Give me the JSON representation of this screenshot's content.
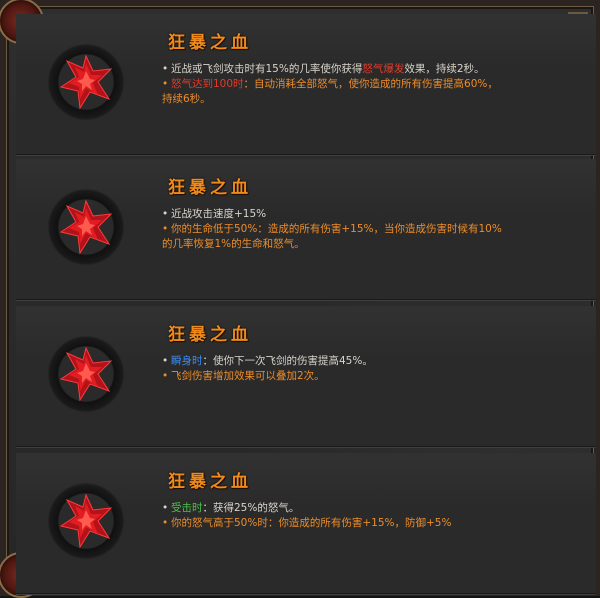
{
  "panels": [
    {
      "title": "狂暴之血",
      "icon": "red-crystal-icon",
      "lines": [
        {
          "bullet": "•",
          "pre": "近战或飞剑攻击时有15%的几率使你获得",
          "hl": "怒气爆发",
          "post": "效果，持续2秒。"
        },
        {
          "bullet": "•",
          "hl": "怒气达到100时",
          "post": "：自动消耗全部怒气，使你造成的所有伤害提高60%，"
        },
        {
          "text": "持续6秒。"
        }
      ]
    },
    {
      "title": "狂暴之血",
      "icon": "red-crystal-icon",
      "lines": [
        {
          "bullet": "•",
          "text": "近战攻击速度+15%"
        },
        {
          "bullet": "•",
          "text": "你的生命低于50%：造成的所有伤害+15%，当你造成伤害时候有10%"
        },
        {
          "text": "的几率恢复1%的生命和怒气。"
        }
      ]
    },
    {
      "title": "狂暴之血",
      "icon": "red-crystal-icon",
      "lines": [
        {
          "bullet": "•",
          "hl": "瞬身时",
          "post": "：使你下一次飞剑的伤害提高45%。"
        },
        {
          "bullet": "•",
          "text": "飞剑伤害增加效果可以叠加2次。"
        }
      ]
    },
    {
      "title": "狂暴之血",
      "icon": "red-crystal-icon",
      "lines": [
        {
          "bullet": "•",
          "hl": "受击时",
          "post": "：获得25%的怒气。"
        },
        {
          "bullet": "•",
          "text": "你的怒气高于50%时：你造成的所有伤害+15%，防御+5%"
        }
      ]
    }
  ],
  "colors": {
    "title": "#f08a1c",
    "text": "#d8d4cc",
    "orange": "#ec8d2a",
    "blue": "#3b8cf0",
    "red": "#e23a2a",
    "green": "#4fc24a"
  }
}
